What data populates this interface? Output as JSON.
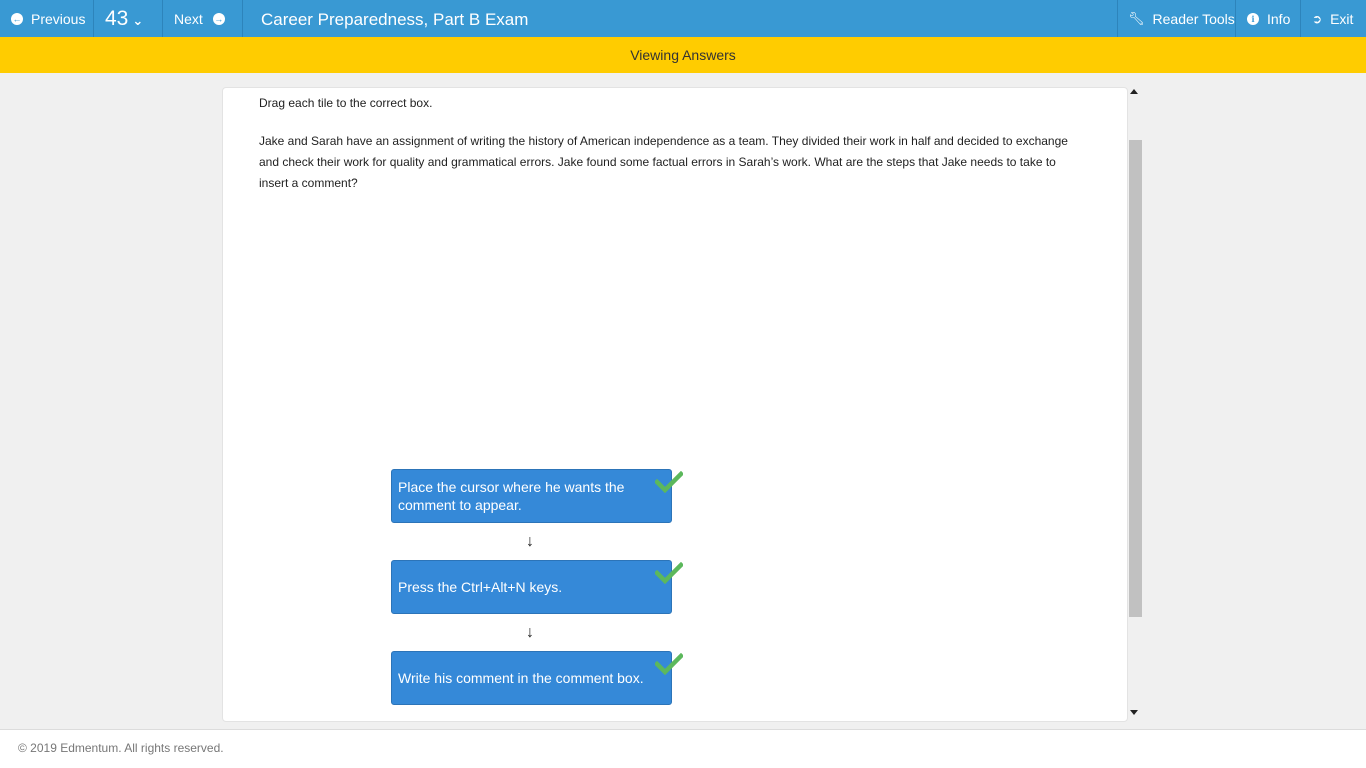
{
  "topbar": {
    "prev_label": "Previous",
    "question_number": "43",
    "next_label": "Next",
    "title": "Career Preparedness, Part B Exam",
    "reader_tools_label": "Reader Tools",
    "info_label": "Info",
    "exit_label": "Exit"
  },
  "banner": {
    "text": "Viewing Answers"
  },
  "question": {
    "instruction": "Drag each tile to the correct box.",
    "text": "Jake and Sarah have an assignment of writing the history of American independence as a team. They divided their work in half and decided to exchange and check their work for quality and grammatical errors. Jake found some factual errors in Sarah’s work. What are the steps that Jake needs to take to insert a comment?"
  },
  "tiles": [
    {
      "text": "Place the cursor where he wants the comment to appear.",
      "status": "correct"
    },
    {
      "text": "Press the Ctrl+Alt+N keys.",
      "status": "correct"
    },
    {
      "text": "Write his comment in the comment box.",
      "status": "correct"
    }
  ],
  "arrow_glyph": "↓",
  "footer": {
    "copyright": "© 2019 Edmentum. All rights reserved."
  },
  "colors": {
    "topbar": "#3999d3",
    "banner": "#ffcc00",
    "tile": "#3589d8",
    "check": "#5cb85c"
  }
}
